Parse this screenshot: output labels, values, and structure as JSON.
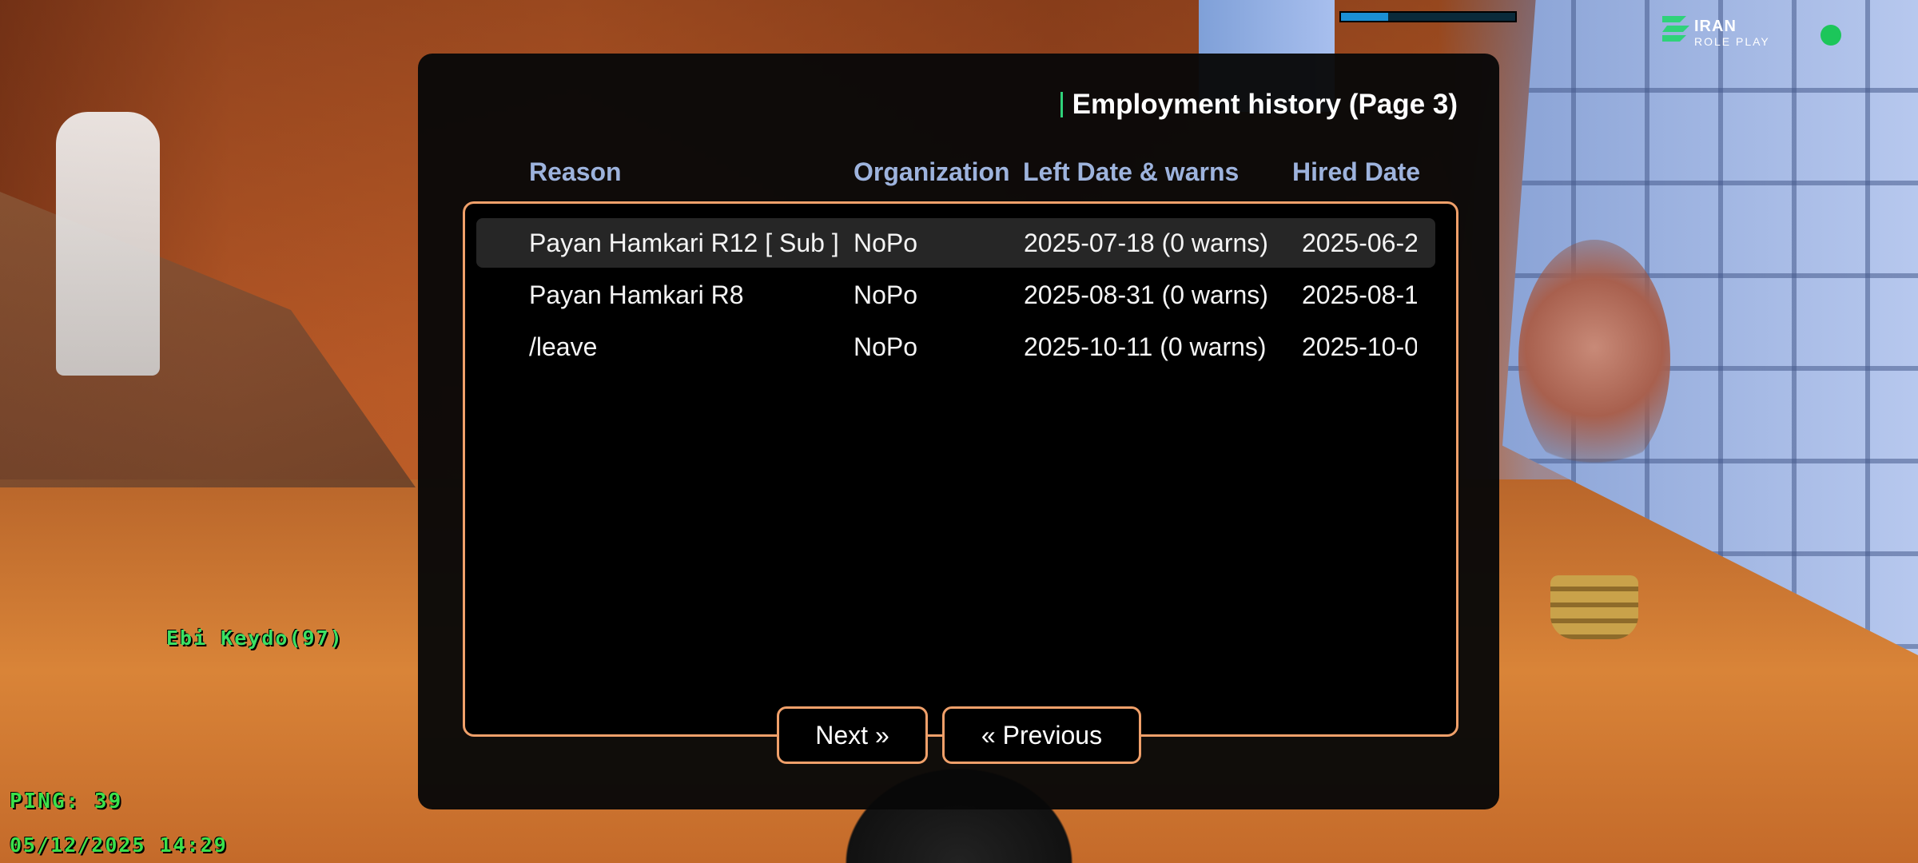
{
  "hud": {
    "logo_line1": "IRAN",
    "logo_line2": "ROLE PLAY",
    "bar_fill": 0.27,
    "player_name": "Ebi Keydo(97)",
    "ping": "PING: 39",
    "datetime": "05/12/2025 14:29",
    "status_color": "#1cc65a"
  },
  "dialog": {
    "title": "Employment history (Page 3)",
    "columns": {
      "reason": "Reason",
      "organization": "Organization",
      "left_date": "Left Date & warns",
      "hired_date": "Hired Date"
    },
    "rows": [
      {
        "reason": "Payan Hamkari R12 [ Sub ]",
        "organization": "NoPo",
        "left_date": "2025-07-18 (0 warns)",
        "hired_date": "2025-06-2"
      },
      {
        "reason": "Payan Hamkari R8",
        "organization": "NoPo",
        "left_date": "2025-08-31 (0 warns)",
        "hired_date": "2025-08-1"
      },
      {
        "reason": "/leave",
        "organization": "NoPo",
        "left_date": "2025-10-11 (0 warns)",
        "hired_date": "2025-10-0"
      }
    ],
    "buttons": {
      "next": "Next »",
      "previous": "« Previous"
    },
    "accent_color": "#f0a06a"
  }
}
